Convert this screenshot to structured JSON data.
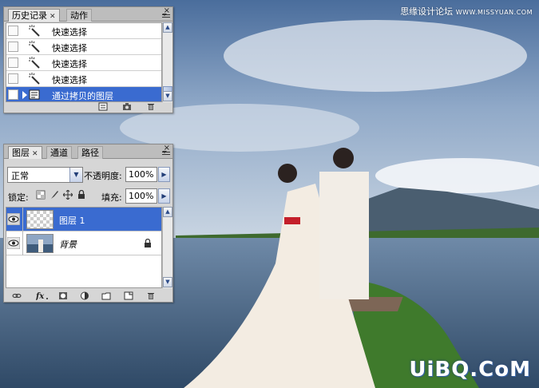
{
  "watermark_top": {
    "site": "思缘设计论坛",
    "url": "WWW.MISSYUAN.COM"
  },
  "watermark_bottom": "UiBQ.CoM",
  "history_panel": {
    "tabs": [
      {
        "label": "历史记录",
        "active": true,
        "closable": true
      },
      {
        "label": "动作",
        "active": false
      }
    ],
    "items": [
      {
        "label": "快速选择",
        "icon": "quick-select-icon",
        "selected": false
      },
      {
        "label": "快速选择",
        "icon": "quick-select-icon",
        "selected": false
      },
      {
        "label": "快速选择",
        "icon": "quick-select-icon",
        "selected": false
      },
      {
        "label": "快速选择",
        "icon": "quick-select-icon",
        "selected": false
      },
      {
        "label": "通过拷贝的图层",
        "icon": "layer-via-copy-icon",
        "selected": true
      }
    ],
    "footer_icons": [
      "new-document-icon",
      "snapshot-icon",
      "trash-icon"
    ]
  },
  "layers_panel": {
    "tabs": [
      {
        "label": "图层",
        "active": true,
        "closable": true
      },
      {
        "label": "通道",
        "active": false
      },
      {
        "label": "路径",
        "active": false
      }
    ],
    "blend_mode": "正常",
    "opacity_label": "不透明度:",
    "opacity_value": "100%",
    "lock_label": "锁定:",
    "fill_label": "填充:",
    "fill_value": "100%",
    "layers": [
      {
        "name": "图层 1",
        "selected": true,
        "visible": true,
        "thumbnail": "transparent",
        "locked": false
      },
      {
        "name": "背景",
        "selected": false,
        "visible": true,
        "thumbnail": "photo",
        "locked": true
      }
    ],
    "footer_icons": [
      "link-icon",
      "fx-icon",
      "mask-icon",
      "adjustment-icon",
      "group-folder-icon",
      "new-layer-icon",
      "trash-icon"
    ]
  },
  "colors": {
    "selection": "#3a6bd0",
    "panel": "#d6d6d6"
  }
}
